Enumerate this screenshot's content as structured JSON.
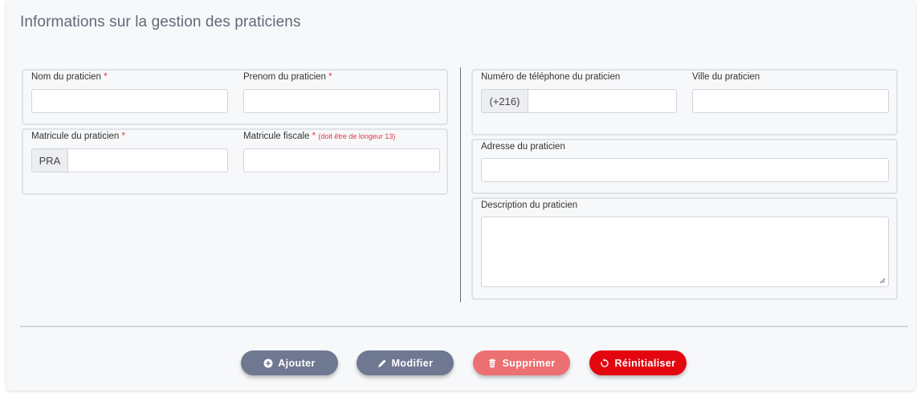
{
  "title": "Informations sur la gestion des praticiens",
  "fields": {
    "nom": {
      "label": "Nom du praticien",
      "required": "*",
      "value": ""
    },
    "prenom": {
      "label": "Prenom du praticien",
      "required": "*",
      "value": ""
    },
    "matricule": {
      "label": "Matricule du praticien",
      "required": "*",
      "prefix": "PRA",
      "value": ""
    },
    "matricule_fiscale": {
      "label": "Matricule fiscale",
      "required": "*",
      "hint": "(doit être de longeur 13)",
      "value": ""
    },
    "telephone": {
      "label": "Numéro de téléphone du praticien",
      "prefix": "(+216)",
      "value": ""
    },
    "ville": {
      "label": "Ville du praticien",
      "value": ""
    },
    "adresse": {
      "label": "Adresse du praticien",
      "value": ""
    },
    "description": {
      "label": "Description du praticien",
      "value": ""
    }
  },
  "buttons": {
    "ajouter": "Ajouter",
    "modifier": "Modifier",
    "supprimer": "Supprimer",
    "reinitialiser": "Réinitialiser"
  },
  "colors": {
    "button_gray": "#6f7891",
    "button_delete": "#ec6f72",
    "button_reset": "#e4060f",
    "required": "#e0393e"
  }
}
